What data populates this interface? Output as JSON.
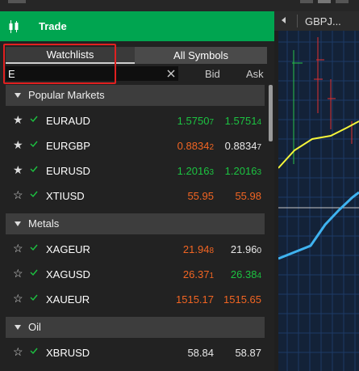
{
  "panel": {
    "title": "Trade",
    "tabs": [
      "Watchlists",
      "All Symbols"
    ],
    "search_value": "E",
    "columns": {
      "bid": "Bid",
      "ask": "Ask"
    }
  },
  "groups": [
    {
      "name": "Popular Markets",
      "rows": [
        {
          "symbol": "EURAUD",
          "starred": true,
          "bid": "1.5750",
          "bid_sfx": "7",
          "bid_color": "green",
          "ask": "1.5751",
          "ask_sfx": "4",
          "ask_color": "green"
        },
        {
          "symbol": "EURGBP",
          "starred": true,
          "bid": "0.8834",
          "bid_sfx": "2",
          "bid_color": "orange",
          "ask": "0.8834",
          "ask_sfx": "7",
          "ask_color": "white"
        },
        {
          "symbol": "EURUSD",
          "starred": true,
          "bid": "1.2016",
          "bid_sfx": "3",
          "bid_color": "green",
          "ask": "1.2016",
          "ask_sfx": "3",
          "ask_color": "green"
        },
        {
          "symbol": "XTIUSD",
          "starred": false,
          "bid": "55.95",
          "bid_sfx": "",
          "bid_color": "orange",
          "ask": "55.98",
          "ask_sfx": "",
          "ask_color": "orange"
        }
      ]
    },
    {
      "name": "Metals",
      "rows": [
        {
          "symbol": "XAGEUR",
          "starred": false,
          "bid": "21.94",
          "bid_sfx": "8",
          "bid_color": "orange",
          "ask": "21.96",
          "ask_sfx": "0",
          "ask_color": "white"
        },
        {
          "symbol": "XAGUSD",
          "starred": false,
          "bid": "26.37",
          "bid_sfx": "1",
          "bid_color": "orange",
          "ask": "26.38",
          "ask_sfx": "4",
          "ask_color": "green"
        },
        {
          "symbol": "XAUEUR",
          "starred": false,
          "bid": "1515.17",
          "bid_sfx": "",
          "bid_color": "orange",
          "ask": "1515.65",
          "ask_sfx": "",
          "ask_color": "orange"
        }
      ]
    },
    {
      "name": "Oil",
      "rows": [
        {
          "symbol": "XBRUSD",
          "starred": false,
          "bid": "58.84",
          "bid_sfx": "",
          "bid_color": "white",
          "ask": "58.87",
          "ask_sfx": "",
          "ask_color": "white"
        }
      ]
    }
  ],
  "chart": {
    "tab_label": "GBPJ..."
  },
  "colors": {
    "brand": "#00a550",
    "up": "#1cc341",
    "down": "#f26522",
    "chart_bg": "#132238",
    "chart_grid": "#1e3a66",
    "highlight": "#e02020",
    "line_yellow": "#f5f53a",
    "line_blue": "#3fb3f0"
  },
  "icons": [
    "candlestick-icon",
    "clear-icon",
    "star-icon",
    "check-icon",
    "caret-down-icon",
    "caret-left-icon"
  ]
}
